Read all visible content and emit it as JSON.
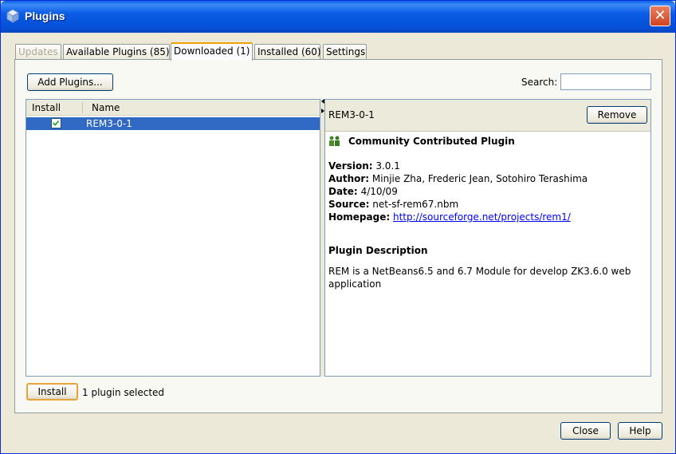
{
  "window": {
    "title": "Plugins"
  },
  "tabs": [
    {
      "label": "Updates",
      "state": "disabled"
    },
    {
      "label": "Available Plugins (85)",
      "state": "normal"
    },
    {
      "label": "Downloaded (1)",
      "state": "active"
    },
    {
      "label": "Installed (60)",
      "state": "normal"
    },
    {
      "label": "Settings",
      "state": "normal"
    }
  ],
  "toolbar": {
    "add_plugins_label": "Add Plugins...",
    "search_label": "Search:",
    "search_value": ""
  },
  "list": {
    "columns": [
      "Install",
      "Name"
    ],
    "rows": [
      {
        "checked": true,
        "name": "REM3-0-1"
      }
    ]
  },
  "detail": {
    "title": "REM3-0-1",
    "remove_label": "Remove",
    "category": "Community Contributed Plugin",
    "version_label": "Version:",
    "version": "3.0.1",
    "author_label": "Author:",
    "author": "Minjie Zha, Frederic Jean, Sotohiro Terashima",
    "date_label": "Date:",
    "date": "4/10/09",
    "source_label": "Source:",
    "source": "net-sf-rem67.nbm",
    "homepage_label": "Homepage:",
    "homepage": "http://sourceforge.net/projects/rem1/",
    "description_title": "Plugin Description",
    "description": "REM is a NetBeans6.5 and 6.7 Module for develop ZK3.6.0 web application"
  },
  "footer": {
    "install_label": "Install",
    "status": "1  plugin selected",
    "close_label": "Close",
    "help_label": "Help"
  },
  "colors": {
    "title_bar": "#0b5ce6",
    "selection": "#316ac5",
    "link": "#0000ff",
    "active_tab_accent": "#f0a000"
  },
  "icons": {
    "window": "netbeans-cube-icon",
    "category": "community-people-icon",
    "check": "checkmark-icon",
    "close": "close-x-icon"
  }
}
